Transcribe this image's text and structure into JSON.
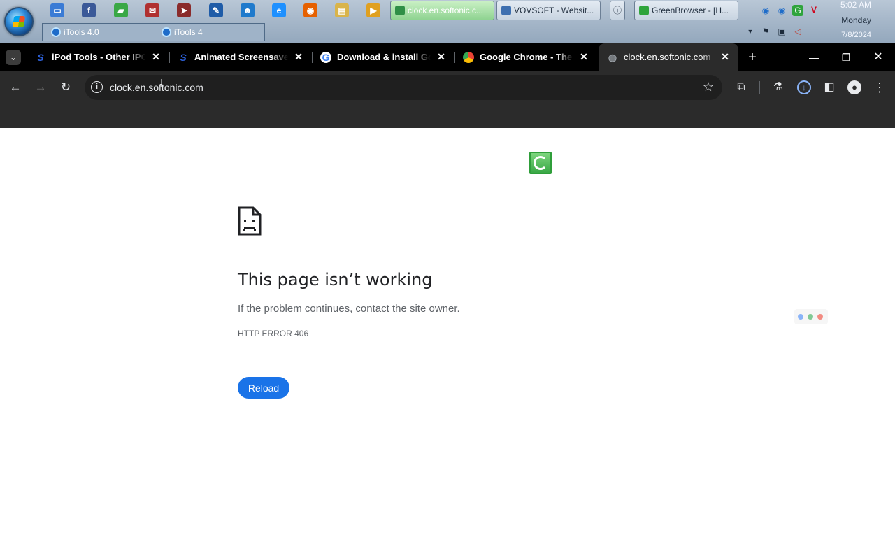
{
  "taskbar": {
    "quick_launch": [
      {
        "icon": "explorer-window-icon",
        "color": "#3a7bd5",
        "glyph": "▭"
      },
      {
        "icon": "facebook-icon",
        "color": "#3b5998",
        "glyph": "f"
      },
      {
        "icon": "green-app-icon",
        "color": "#3aa846",
        "glyph": "▰"
      },
      {
        "icon": "mail-app-icon",
        "color": "#b03030",
        "glyph": "✉"
      },
      {
        "icon": "arrow-app-icon",
        "color": "#8a2b2b",
        "glyph": "➤"
      },
      {
        "icon": "editor-app-icon",
        "color": "#1f5ca8",
        "glyph": "✎"
      },
      {
        "icon": "people-app-icon",
        "color": "#1f7acc",
        "glyph": "☻"
      },
      {
        "icon": "internet-explorer-icon",
        "color": "#1e90ff",
        "glyph": "e"
      },
      {
        "icon": "firefox-icon",
        "color": "#e66000",
        "glyph": "◉"
      },
      {
        "icon": "folder-icon",
        "color": "#d9b44a",
        "glyph": "▤"
      },
      {
        "icon": "media-player-icon",
        "color": "#e0a020",
        "glyph": "▶"
      }
    ],
    "windows": [
      {
        "label": "clock.en.softonic.c...",
        "active": true,
        "icon": "chrome-window-icon"
      },
      {
        "label": "VOVSOFT - Websit...",
        "active": false,
        "icon": "vovsoft-window-icon"
      },
      {
        "label": "GreenBrowser - [H...",
        "active": false,
        "icon": "greenbrowser-window-icon"
      }
    ],
    "group_tabs": [
      "iTools 4.0",
      "iTools 4"
    ],
    "tray": {
      "time": "5:02 AM",
      "day": "Monday",
      "date": "7/8/2024"
    }
  },
  "browser": {
    "tabs": [
      {
        "title": "iPod Tools - Other IPOD",
        "favicon": "softonic-icon",
        "active": false
      },
      {
        "title": "Animated Screensaver M",
        "favicon": "softonic-icon",
        "active": false
      },
      {
        "title": "Download & install Goo",
        "favicon": "google-icon",
        "active": false
      },
      {
        "title": "Google Chrome - The Fa",
        "favicon": "chrome-icon",
        "active": false
      },
      {
        "title": "clock.en.softonic.com",
        "favicon": "globe-icon",
        "active": true
      }
    ],
    "address": "clock.en.softonic.com"
  },
  "page": {
    "title": "This page isn’t working",
    "message": "If the problem continues, contact the site owner.",
    "error_code": "HTTP ERROR 406",
    "reload_label": "Reload"
  },
  "colors": {
    "accent": "#1a73e8",
    "dot_blue": "#8ab4f8",
    "dot_green": "#81c995",
    "dot_red": "#f28b82"
  }
}
